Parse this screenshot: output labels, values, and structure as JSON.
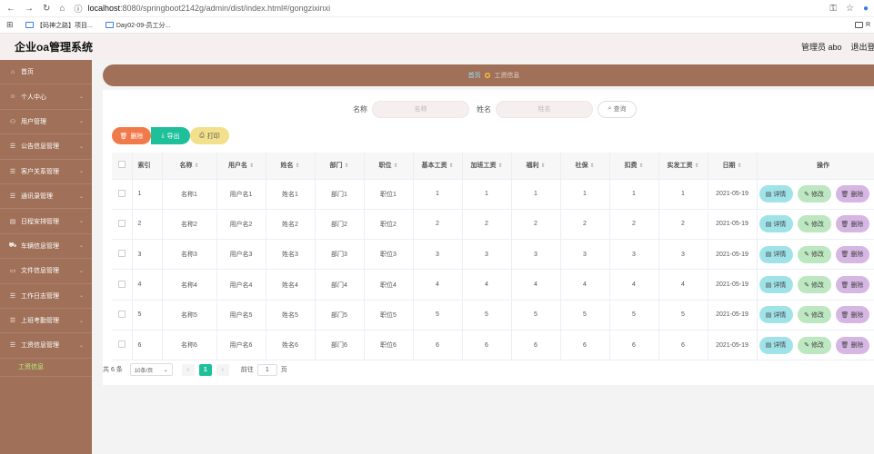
{
  "browser": {
    "nav_icons": [
      "back-icon",
      "forward-icon",
      "reload-icon",
      "home-icon"
    ],
    "url_host": "localhost",
    "url_path": ":8080/springboot2142g/admin/dist/index.html#/gongzixinxi",
    "bookmarks": [
      "【码神之路】项目...",
      "Day02-09-员工分..."
    ],
    "bookmarks_right": "R"
  },
  "app": {
    "title": "企业oa管理系统",
    "user_label": "管理员 abo",
    "logout_label": "退出登录"
  },
  "sidebar": {
    "items": [
      {
        "label": "首页",
        "icon": "home-icon",
        "chevron": false
      },
      {
        "label": "个人中心",
        "icon": "user-icon",
        "chevron": true
      },
      {
        "label": "用户管理",
        "icon": "users-icon",
        "chevron": true
      },
      {
        "label": "公告信息管理",
        "icon": "notice-icon",
        "chevron": true
      },
      {
        "label": "客户关系管理",
        "icon": "customer-icon",
        "chevron": true
      },
      {
        "label": "通讯录管理",
        "icon": "contacts-icon",
        "chevron": true
      },
      {
        "label": "日程安排管理",
        "icon": "calendar-icon",
        "chevron": true
      },
      {
        "label": "车辆信息管理",
        "icon": "car-icon",
        "chevron": true
      },
      {
        "label": "文件信息管理",
        "icon": "file-icon",
        "chevron": true
      },
      {
        "label": "工作日志管理",
        "icon": "log-icon",
        "chevron": true
      },
      {
        "label": "上班考勤管理",
        "icon": "attendance-icon",
        "chevron": true
      },
      {
        "label": "工资信息管理",
        "icon": "salary-icon",
        "chevron": true
      }
    ],
    "sub_item": "工资信息"
  },
  "breadcrumb": {
    "home": "首页",
    "current": "工资信息"
  },
  "search": {
    "name_label": "名称",
    "name_placeholder": "名称",
    "person_label": "姓名",
    "person_placeholder": "姓名",
    "button": "查询"
  },
  "actions": {
    "delete": "删除",
    "export": "导出",
    "print": "打印"
  },
  "table": {
    "headers": [
      "索引",
      "名称",
      "用户名",
      "姓名",
      "部门",
      "职位",
      "基本工资",
      "加班工资",
      "福利",
      "社保",
      "扣费",
      "实发工资",
      "日期",
      "操作"
    ],
    "rows": [
      [
        "1",
        "名称1",
        "用户名1",
        "姓名1",
        "部门1",
        "职位1",
        "1",
        "1",
        "1",
        "1",
        "1",
        "1",
        "2021-05-19"
      ],
      [
        "2",
        "名称2",
        "用户名2",
        "姓名2",
        "部门2",
        "职位2",
        "2",
        "2",
        "2",
        "2",
        "2",
        "2",
        "2021-05-19"
      ],
      [
        "3",
        "名称3",
        "用户名3",
        "姓名3",
        "部门3",
        "职位3",
        "3",
        "3",
        "3",
        "3",
        "3",
        "3",
        "2021-05-19"
      ],
      [
        "4",
        "名称4",
        "用户名4",
        "姓名4",
        "部门4",
        "职位4",
        "4",
        "4",
        "4",
        "4",
        "4",
        "4",
        "2021-05-19"
      ],
      [
        "5",
        "名称5",
        "用户名5",
        "姓名5",
        "部门5",
        "职位5",
        "5",
        "5",
        "5",
        "5",
        "5",
        "5",
        "2021-05-19"
      ],
      [
        "6",
        "名称6",
        "用户名6",
        "姓名6",
        "部门6",
        "职位6",
        "6",
        "6",
        "6",
        "6",
        "6",
        "6",
        "2021-05-19"
      ]
    ],
    "op_labels": {
      "detail": "详情",
      "edit": "修改",
      "delete": "删除"
    }
  },
  "pager": {
    "total": "共 6 条",
    "page_size": "10条/页",
    "current_page": "1",
    "goto_label": "前往",
    "goto_value": "1",
    "page_unit": "页"
  },
  "colors": {
    "sidebar": "#a07058",
    "accent_green": "#1ec09a",
    "delete_orange": "#f17a4a",
    "print_yellow": "#f3e08a",
    "detail_cyan": "#9fe3e9",
    "edit_green": "#bce7c0",
    "delete_purple": "#d6b6e3",
    "header_bg": "#f5efef"
  }
}
